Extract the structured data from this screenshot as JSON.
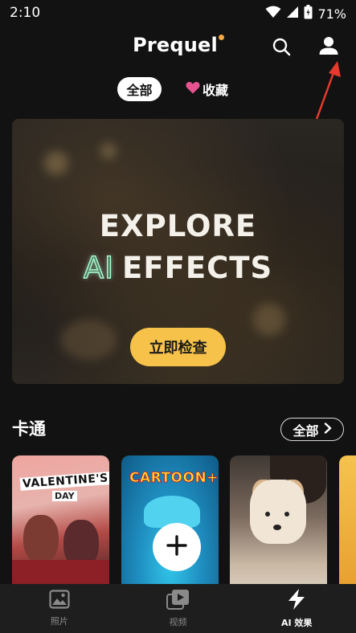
{
  "status_bar": {
    "time": "2:10",
    "battery_pct": "71%"
  },
  "header": {
    "logo_text": "Prequel",
    "icons": [
      "search-icon",
      "profile-icon"
    ]
  },
  "filter_tabs": [
    {
      "label": "全部",
      "selected": true
    },
    {
      "label": "收藏",
      "icon": "heart-icon",
      "selected": false
    }
  ],
  "banner": {
    "line1": "EXPLORE",
    "ai_mark": "AI",
    "line2": "EFFECTS",
    "cta_label": "立即检查"
  },
  "section": {
    "title": "卡通",
    "see_all_label": "全部"
  },
  "cards": [
    {
      "caption_a": "VALENTINE'S",
      "caption_b": "DAY"
    },
    {
      "caption_a": "CARTOON+"
    },
    {
      "caption_a": ""
    },
    {
      "caption_a": ""
    }
  ],
  "bottom_nav": [
    {
      "label": "照片",
      "icon": "photo-icon",
      "active": false
    },
    {
      "label": "视频",
      "icon": "video-icon",
      "active": false
    },
    {
      "label": "AI 效果",
      "icon": "lightning-icon",
      "active": true
    }
  ],
  "colors": {
    "background": "#121212",
    "accent_yellow": "#f7c24a",
    "logo_dot": "#f5a742",
    "heart_pink": "#e6538f",
    "annotation_red": "#e5392d"
  }
}
